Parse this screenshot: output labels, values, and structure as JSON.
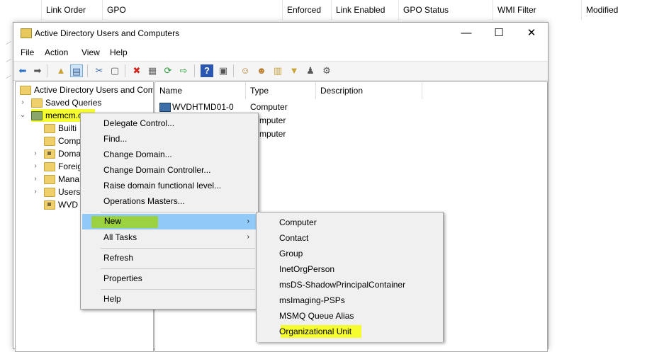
{
  "background_gpo_list": {
    "columns": [
      "Link Order",
      "GPO",
      "Enforced",
      "Link Enabled",
      "GPO Status",
      "WMI Filter",
      "Modified"
    ]
  },
  "window": {
    "title": "Active Directory Users and Computers",
    "minimize": "—",
    "maximize": "☐",
    "close": "✕"
  },
  "menubar": [
    "File",
    "Action",
    "View",
    "Help"
  ],
  "toolbar_icons": [
    "back-icon",
    "forward-icon",
    "up-folder-icon",
    "console-tree-icon",
    "cut-icon",
    "copy-icon",
    "delete-icon",
    "properties-icon",
    "refresh-icon",
    "export-icon",
    "help-icon",
    "action-pane-icon",
    "new-user-icon",
    "new-group-icon",
    "new-ou-icon",
    "filter-icon",
    "delegate-icon"
  ],
  "tree": {
    "root": "Active Directory Users and Com",
    "saved_queries": "Saved Queries",
    "domain": "memcm.com",
    "children": [
      "Builtin",
      "Computers",
      "Domain Controllers",
      "ForeignSecurityPrincipals",
      "Managed Service Accounts",
      "Users",
      "WVD"
    ],
    "children_visible": [
      "Builti",
      "Comp",
      "Doma",
      "Foreig",
      "Mana",
      "Users",
      "WVD"
    ]
  },
  "list": {
    "columns": [
      "Name",
      "Type",
      "Description"
    ],
    "rows": [
      {
        "name": "WVDHTMD01-0",
        "type": "Computer"
      },
      {
        "name": "",
        "type": "mputer"
      },
      {
        "name": "",
        "type": "mputer"
      }
    ]
  },
  "context_menu": {
    "items": [
      "Delegate Control...",
      "Find...",
      "Change Domain...",
      "Change Domain Controller...",
      "Raise domain functional level...",
      "Operations Masters..."
    ],
    "new_label": "New",
    "all_tasks_label": "All Tasks",
    "refresh_label": "Refresh",
    "properties_label": "Properties",
    "help_label": "Help",
    "submenu_arrow": "›"
  },
  "new_submenu": {
    "items": [
      "Computer",
      "Contact",
      "Group",
      "InetOrgPerson",
      "msDS-ShadowPrincipalContainer",
      "msImaging-PSPs",
      "MSMQ Queue Alias",
      "Organizational Unit"
    ]
  },
  "colors": {
    "highlight_yellow": "#f6fd2f",
    "highlight_green": "#9bd32c",
    "menu_selected": "#91c9f7"
  }
}
